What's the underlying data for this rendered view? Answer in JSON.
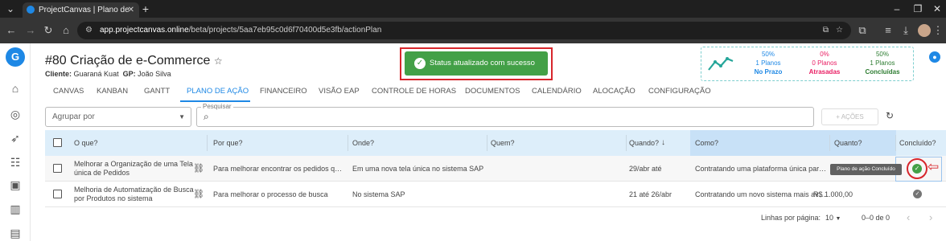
{
  "browser": {
    "tab_title": "ProjectCanvas | Plano de Ação",
    "url_host": "app.projectcanvas.online",
    "url_path": "/beta/projects/5aa7eb95c0d6f70400d5e3fb/actionPlan"
  },
  "header": {
    "title": "#80 Criação de e-Commerce",
    "client_label": "Cliente:",
    "client_value": "Guaraná Kuat",
    "gp_label": "GP:",
    "gp_value": "João Silva"
  },
  "toast": {
    "message": "Status atualizado com sucesso",
    "color": "#43a047"
  },
  "stats": [
    {
      "percent": "50%",
      "count": "1 Planos",
      "label": "No Prazo",
      "color": "#1e88e5"
    },
    {
      "percent": "0%",
      "count": "0 Planos",
      "label": "Atrasadas",
      "color": "#e91e63"
    },
    {
      "percent": "50%",
      "count": "1 Planos",
      "label": "Concluídas",
      "color": "#2e7d32"
    }
  ],
  "tabs": [
    "CANVAS",
    "KANBAN",
    "GANTT",
    "PLANO DE AÇÃO",
    "FINANCEIRO",
    "VISÃO EAP",
    "CONTROLE DE HORAS",
    "DOCUMENTOS",
    "CALENDÁRIO",
    "ALOCAÇÃO",
    "CONFIGURAÇÃO"
  ],
  "active_tab": "PLANO DE AÇÃO",
  "filters": {
    "group_placeholder": "Agrupar por",
    "search_label": "Pesquisar",
    "actions_label": "+ AÇÕES"
  },
  "table": {
    "columns": [
      "O que?",
      "Por que?",
      "Onde?",
      "Quem?",
      "Quando?",
      "Como?",
      "Quanto?",
      "Concluído?"
    ],
    "rows": [
      {
        "what_1": "Melhorar a Organização de uma Tela",
        "what_2": "única de Pedidos",
        "why": "Para melhorar encontrar os pedidos q…",
        "where": "Em uma nova tela única no sistema SAP",
        "who": "",
        "when": "29/abr até",
        "how": "Contratando uma plataforma única par…",
        "how_much": "",
        "done": true
      },
      {
        "what_1": "Melhoria de Automatização de Busca",
        "what_2": "por Produtos no sistema",
        "why": "Para melhorar o processo de busca",
        "where": "No sistema SAP",
        "who": "",
        "when": "21 até 26/abr",
        "how": "Contratando um novo sistema mais av…",
        "how_much": "R$ 1.000,00",
        "done": true
      }
    ]
  },
  "tooltip": "Plano de ação Concluído",
  "pagination": {
    "rows_per_page_label": "Linhas por página:",
    "rows_per_page_value": "10",
    "range": "0–0 de 0"
  }
}
